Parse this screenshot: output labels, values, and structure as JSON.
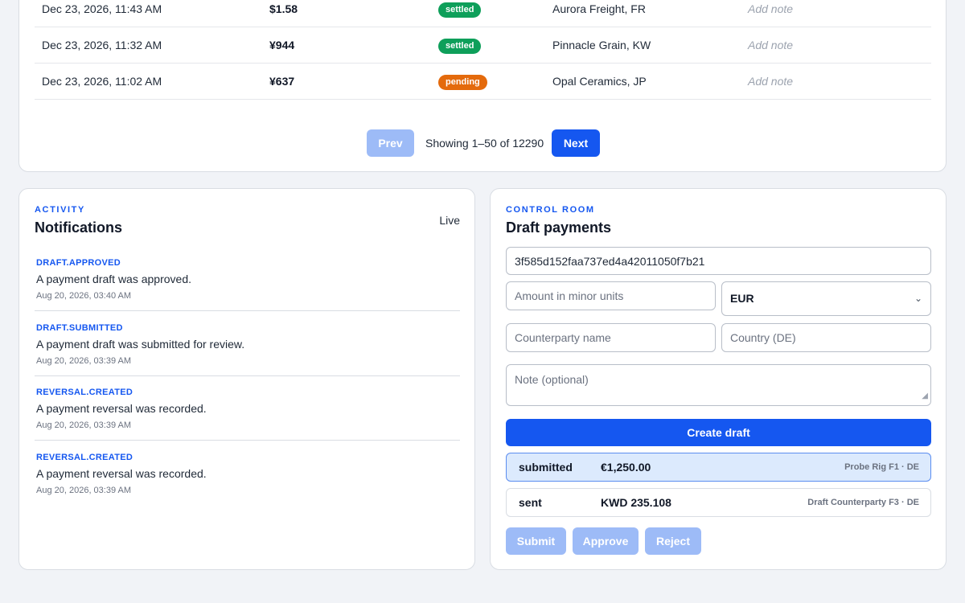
{
  "transactions": [
    {
      "date": "Dec 23, 2026, 11:43 AM",
      "amount": "$1.58",
      "status": "settled",
      "counterparty": "Aurora Freight, FR",
      "note": "Add note"
    },
    {
      "date": "Dec 23, 2026, 11:32 AM",
      "amount": "¥944",
      "status": "settled",
      "counterparty": "Pinnacle Grain, KW",
      "note": "Add note"
    },
    {
      "date": "Dec 23, 2026, 11:02 AM",
      "amount": "¥637",
      "status": "pending",
      "counterparty": "Opal Ceramics, JP",
      "note": "Add note"
    }
  ],
  "pagination": {
    "prev_label": "Prev",
    "next_label": "Next",
    "summary": "Showing 1–50 of 12290"
  },
  "notifications": {
    "eyebrow": "ACTIVITY",
    "title": "Notifications",
    "live_label": "Live",
    "items": [
      {
        "type": "DRAFT.APPROVED",
        "message": "A payment draft was approved.",
        "time": "Aug 20, 2026, 03:40 AM"
      },
      {
        "type": "DRAFT.SUBMITTED",
        "message": "A payment draft was submitted for review.",
        "time": "Aug 20, 2026, 03:39 AM"
      },
      {
        "type": "REVERSAL.CREATED",
        "message": "A payment reversal was recorded.",
        "time": "Aug 20, 2026, 03:39 AM"
      },
      {
        "type": "REVERSAL.CREATED",
        "message": "A payment reversal was recorded.",
        "time": "Aug 20, 2026, 03:39 AM"
      }
    ]
  },
  "draft_payments": {
    "eyebrow": "CONTROL ROOM",
    "title": "Draft payments",
    "id_value": "3f585d152faa737ed4a42011050f7b21",
    "amount_placeholder": "Amount in minor units",
    "currency_selected": "EUR",
    "counterparty_placeholder": "Counterparty name",
    "country_placeholder": "Country (DE)",
    "note_placeholder": "Note (optional)",
    "create_label": "Create draft",
    "drafts": [
      {
        "status": "submitted",
        "amount": "€1,250.00",
        "counterparty": "Probe Rig F1 · DE",
        "selected": true
      },
      {
        "status": "sent",
        "amount": "KWD 235.108",
        "counterparty": "Draft Counterparty F3 · DE",
        "selected": false
      }
    ],
    "submit_label": "Submit",
    "approve_label": "Approve",
    "reject_label": "Reject"
  },
  "colors": {
    "accent": "#1557f0",
    "accent_disabled": "#9dbbf7",
    "settled": "#0e9f5a",
    "pending": "#e46a0c"
  }
}
